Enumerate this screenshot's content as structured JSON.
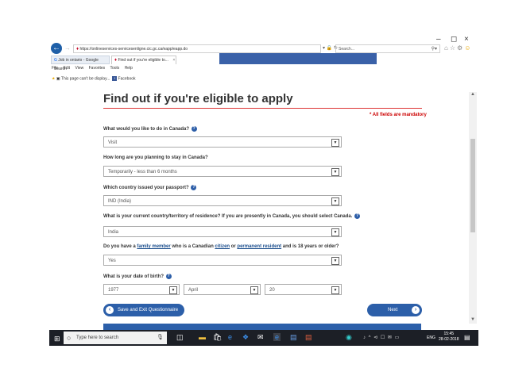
{
  "browser": {
    "url": "https://onlineservices-servicesenligne.cic.gc.ca/eapp/eapp.do",
    "search_placeholder": "Search...",
    "tabs": [
      "Job in ontario - Google Search",
      "Find out if you're eligible to..."
    ],
    "menu": [
      "File",
      "Edit",
      "View",
      "Favorites",
      "Tools",
      "Help"
    ],
    "favorites": [
      "This page can't be display...",
      "Facebook"
    ]
  },
  "page": {
    "title": "Find out if you're eligible to apply",
    "mandatory_note": "* All fields are mandatory",
    "q1": "What would you like to do in Canada?",
    "a1": "Visit",
    "q2": "How long are you planning to stay in Canada?",
    "a2": "Temporarily - less than 6 months",
    "q3": "Which country issued your passport?",
    "a3": "IND (India)",
    "q4": "What is your current country/territory of residence? If you are presently in Canada, you should select Canada.",
    "a4": "India",
    "q5": {
      "t1": "Do you have a ",
      "l1": "family member",
      "t2": " who is a Canadian ",
      "l2": "citizen",
      "t3": " or ",
      "l3": "permanent resident",
      "t4": " and is 18 years or older?"
    },
    "a5": "Yes",
    "q6": "What is your date of birth?",
    "dob_year": "1977",
    "dob_month": "April",
    "dob_day": "20",
    "save_button": "Save and Exit Questionnaire",
    "next_button": "Next"
  },
  "taskbar": {
    "search_placeholder": "Type here to search",
    "lang": "ENG",
    "time": "15:45",
    "date": "28-02-2018"
  }
}
